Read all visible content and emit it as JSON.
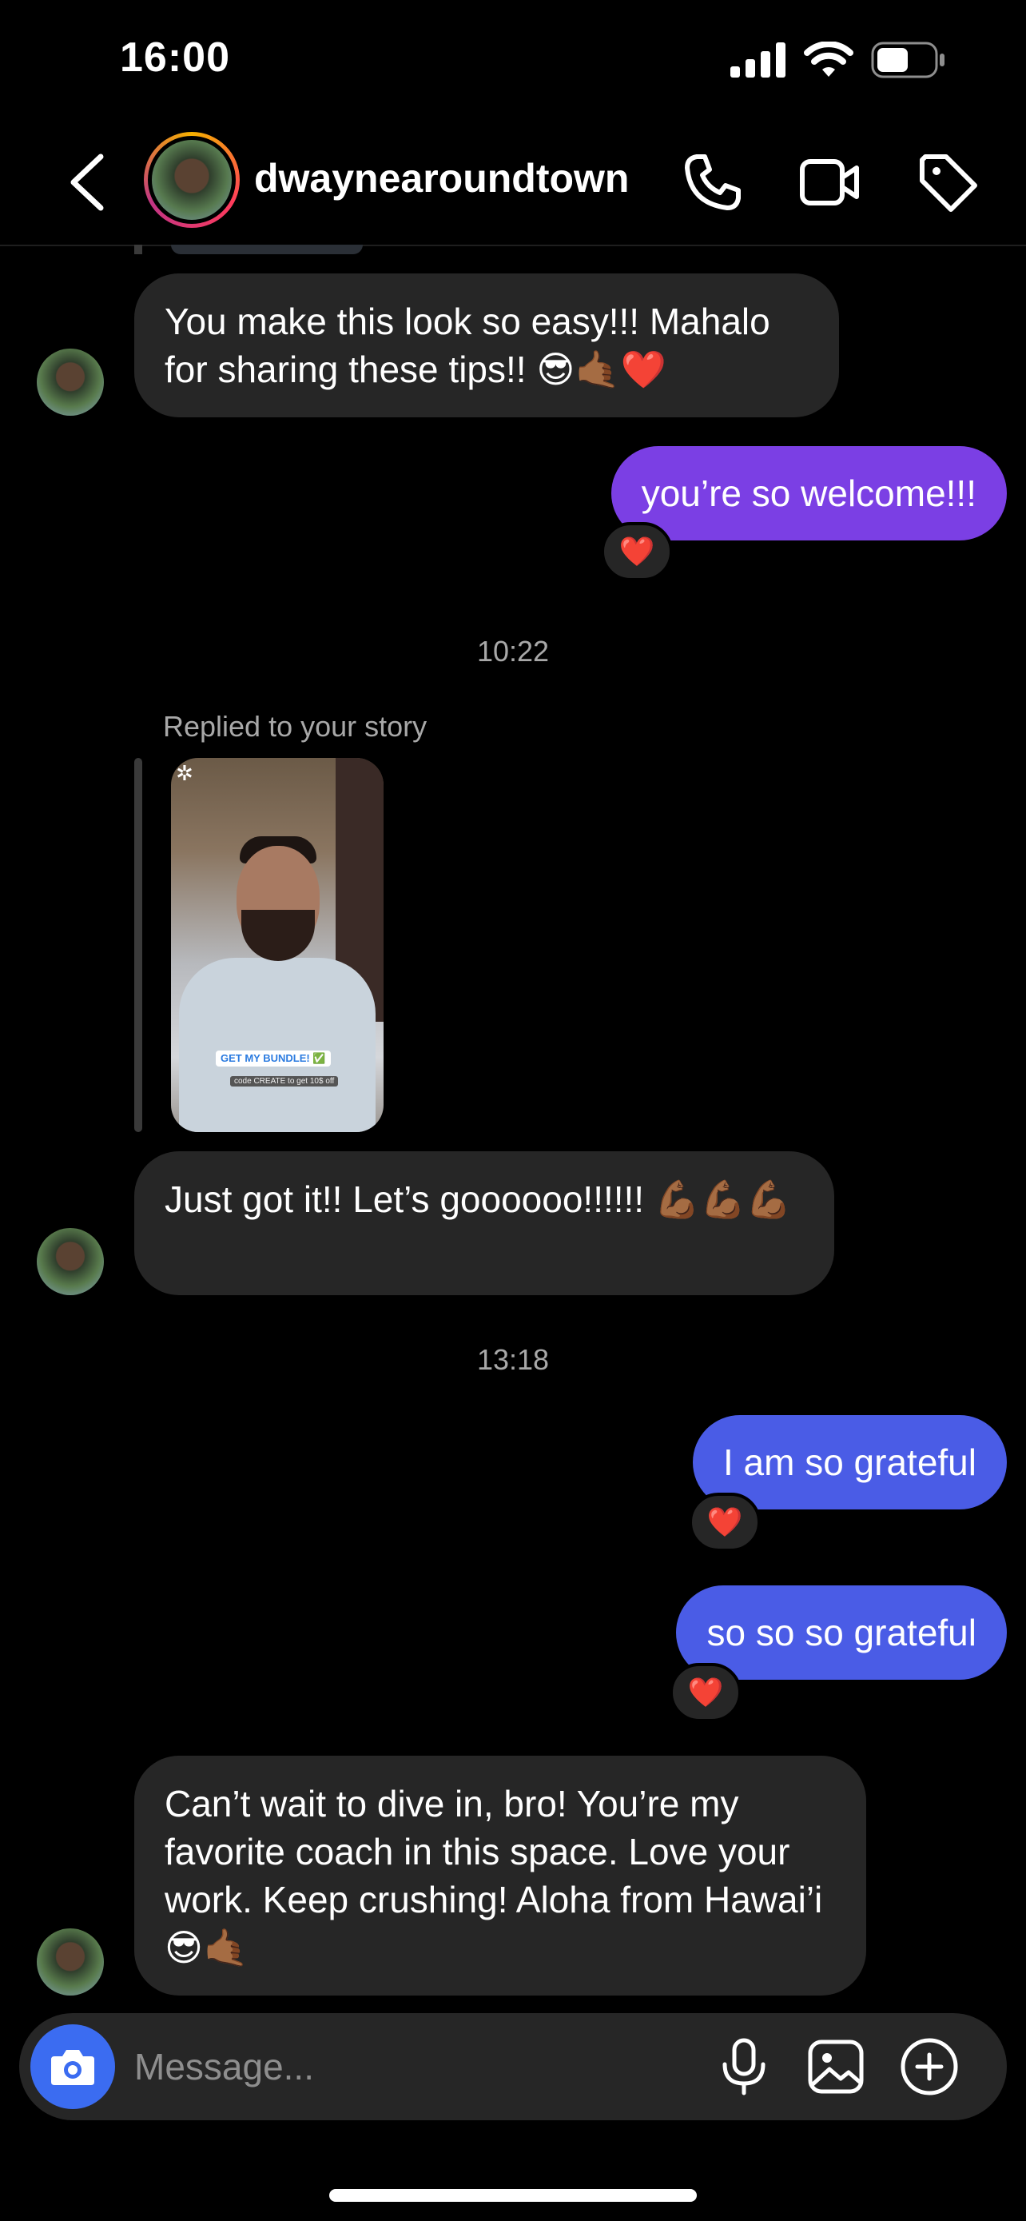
{
  "status_bar": {
    "time": "16:00"
  },
  "header": {
    "username": "dwaynearoundtown"
  },
  "messages": {
    "m1": {
      "text": "You make this look so easy!!! Mahalo for sharing these tips!! 😎🤙🏾❤️"
    },
    "m2": {
      "text": "you’re so welcome!!!",
      "reaction": "❤️",
      "color": "#7b3fe4"
    },
    "ts1": "10:22",
    "story_reply": {
      "label": "Replied to your story",
      "cta": "GET MY BUNDLE! ✅",
      "code": "code CREATE to get 10$ off"
    },
    "m3": {
      "text": "Just got it!! Let’s goooooo!!!!!! 💪🏾💪🏾💪🏾"
    },
    "ts2": "13:18",
    "m4": {
      "text": "I am so grateful",
      "reaction": "❤️",
      "color": "#4a5ce6"
    },
    "m5": {
      "text": "so so so grateful",
      "reaction": "❤️",
      "color": "#4a5ce6"
    },
    "m6": {
      "text": "Can’t wait to dive in, bro! You’re my favorite coach in this space. Love your work. Keep crushing! Aloha from Hawai’i😎🤙🏾"
    }
  },
  "composer": {
    "placeholder": "Message..."
  }
}
